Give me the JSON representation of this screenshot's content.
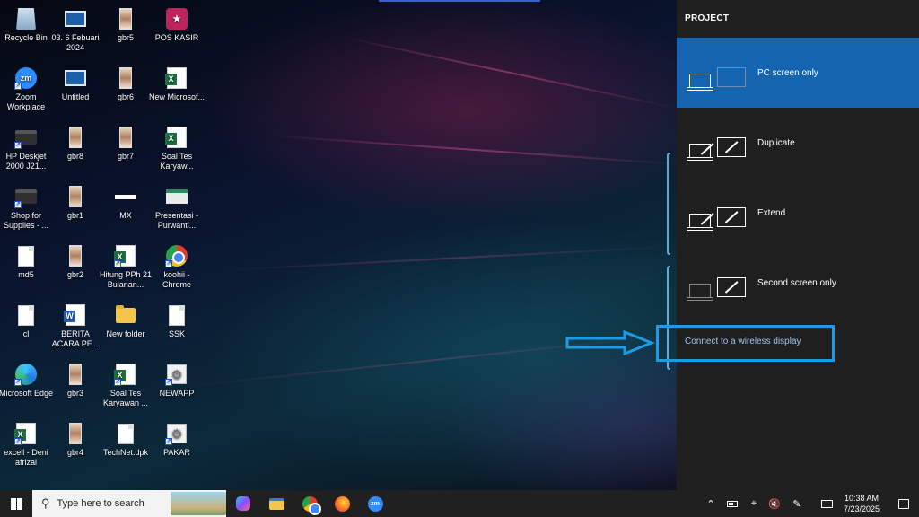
{
  "desktop": {
    "icons": [
      {
        "label": "Recycle Bin",
        "icon": "recycle-bin-icon"
      },
      {
        "label": "03. 6 Febuari 2024",
        "icon": "image-icon"
      },
      {
        "label": "gbr5",
        "icon": "photo-icon"
      },
      {
        "label": "POS KASIR",
        "icon": "app-icon"
      },
      {
        "label": "Zoom Workplace",
        "icon": "zoom-icon"
      },
      {
        "label": "Untitled",
        "icon": "image-icon"
      },
      {
        "label": "gbr6",
        "icon": "photo-icon"
      },
      {
        "label": "New Microsof...",
        "icon": "excel-icon"
      },
      {
        "label": "HP Deskjet 2000 J21...",
        "icon": "printer-icon"
      },
      {
        "label": "gbr8",
        "icon": "photo-icon"
      },
      {
        "label": "gbr7",
        "icon": "photo-icon"
      },
      {
        "label": "Soal Tes Karyaw...",
        "icon": "excel-icon"
      },
      {
        "label": "Shop for Supplies - ...",
        "icon": "printer-icon"
      },
      {
        "label": "gbr1",
        "icon": "photo-icon"
      },
      {
        "label": "MX",
        "icon": "file-icon"
      },
      {
        "label": "Presentasi - Purwanti...",
        "icon": "presentation-icon"
      },
      {
        "label": "md5",
        "icon": "document-icon"
      },
      {
        "label": "gbr2",
        "icon": "photo-icon"
      },
      {
        "label": "Hitung PPh 21 Bulanan...",
        "icon": "excel-icon"
      },
      {
        "label": "koohii - Chrome",
        "icon": "chrome-icon"
      },
      {
        "label": "cl",
        "icon": "document-icon"
      },
      {
        "label": "BERITA ACARA PE...",
        "icon": "word-icon"
      },
      {
        "label": "New folder",
        "icon": "folder-icon"
      },
      {
        "label": "SSK",
        "icon": "document-icon"
      },
      {
        "label": "Microsoft Edge",
        "icon": "edge-icon"
      },
      {
        "label": "gbr3",
        "icon": "photo-icon"
      },
      {
        "label": "Soal Tes Karyawan ...",
        "icon": "excel-icon"
      },
      {
        "label": "NEWAPP",
        "icon": "settings-file-icon"
      },
      {
        "label": "excell - Deni afrizal",
        "icon": "excel-icon"
      },
      {
        "label": "gbr4",
        "icon": "photo-icon"
      },
      {
        "label": "TechNet.dpk",
        "icon": "document-icon"
      },
      {
        "label": "PAKAR",
        "icon": "settings-file-icon"
      }
    ]
  },
  "project_panel": {
    "title": "PROJECT",
    "options": [
      {
        "label": "PC screen only",
        "selected": true
      },
      {
        "label": "Duplicate",
        "selected": false
      },
      {
        "label": "Extend",
        "selected": false
      },
      {
        "label": "Second screen only",
        "selected": false
      }
    ],
    "wireless_link": "Connect to a wireless display",
    "accent_color": "#1564b0",
    "highlight_color": "#1d9ce6"
  },
  "taskbar": {
    "search_placeholder": "Type here to search",
    "apps": [
      "copilot-icon",
      "file-explorer-icon",
      "chrome-icon",
      "firefox-icon",
      "zoom-icon"
    ],
    "tray_icons": [
      "chevron-up-icon",
      "battery-icon",
      "wifi-icon",
      "volume-muted-icon",
      "pen-icon",
      "keyboard-icon"
    ],
    "time": "10:38 AM",
    "date": "7/23/2025"
  }
}
